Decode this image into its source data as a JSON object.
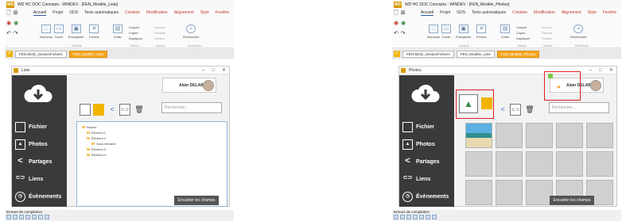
{
  "ribbon": {
    "tabs": [
      "Accueil",
      "Projet",
      "GDS",
      "Tests automatiques",
      "Création",
      "Modification",
      "Alignement",
      "Style",
      "Fenêtre"
    ],
    "nouveau": "Nouveau",
    "ouvrir": "Ouvrir",
    "enregistrer": "Enregistrer",
    "fermer": "Fermer",
    "coller": "Coller",
    "couper": "Couper",
    "copier": "Copier",
    "dupliquer": "Dupliquer",
    "annuler": "Annuler",
    "retablir": "Rétablir",
    "refaire": "Refaire",
    "rechercher": "Rechercher",
    "group_general": "Général",
    "group_edition": "Édition",
    "group_actions": "Actions",
    "group_recherche": "Recherche"
  },
  "sidebar": {
    "items": [
      "Fichier",
      "Photos",
      "Partages",
      "Liens",
      "Évènements"
    ]
  },
  "left": {
    "title": "WD HC DOC Concepts - WINDEV - [FEN_Modèle_Liste]",
    "doc_tabs": [
      "FEN-MOD_GestionFichiers",
      "FEN_Modèle_Liste"
    ],
    "window_title": "Liste",
    "user": "Alain DELABAT",
    "search_placeholder": "Rechercher...",
    "tree": [
      "Racine",
      "Élément 1",
      "Élément 2",
      "Sous élément",
      "Élément 3",
      "Élément 4"
    ],
    "button": "Encadrer les champs",
    "status": "Erreurs de compilation"
  },
  "right": {
    "title": "WD HC DOC Concepts - WINDEV - [FEN_Modèle_Photos]",
    "doc_tabs": [
      "FEN-MOD_GestionFichiers",
      "FEN_Modèle_Liste",
      "FEN_Modèle_Photos"
    ],
    "window_title": "Photos",
    "user": "Alain DELABAT",
    "search_placeholder": "Rechercher...",
    "button": "Encadrer les champs",
    "status": "Erreurs de compilation"
  }
}
